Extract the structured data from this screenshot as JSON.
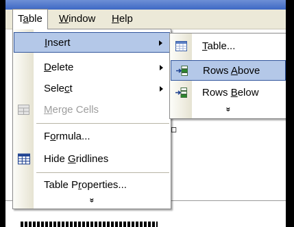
{
  "menubar": {
    "table": {
      "pre": "T",
      "key": "a",
      "post": "ble"
    },
    "window": {
      "pre": "",
      "key": "W",
      "post": "indow"
    },
    "help": {
      "pre": "",
      "key": "H",
      "post": "elp"
    }
  },
  "table_menu": {
    "insert": {
      "pre": "",
      "key": "I",
      "post": "nsert"
    },
    "delete": {
      "pre": "",
      "key": "D",
      "post": "elete"
    },
    "select": {
      "pre": "Sele",
      "key": "c",
      "post": "t"
    },
    "merge_cells": {
      "pre": "",
      "key": "M",
      "post": "erge Cells"
    },
    "formula": {
      "pre": "F",
      "key": "o",
      "post": "rmula..."
    },
    "hide_gridlines": {
      "pre": "Hide ",
      "key": "G",
      "post": "ridlines"
    },
    "table_properties": {
      "pre": "Table P",
      "key": "r",
      "post": "operties..."
    },
    "more": "»"
  },
  "insert_menu": {
    "table": {
      "pre": "",
      "key": "T",
      "post": "able..."
    },
    "rows_above": {
      "pre": "Rows ",
      "key": "A",
      "post": "bove"
    },
    "rows_below": {
      "pre": "Rows ",
      "key": "B",
      "post": "elow"
    },
    "more": "»"
  },
  "doc": {
    "mark": "¨",
    "box": "□"
  },
  "icons": {
    "merge_cells": "merge-cells-icon",
    "hide_gridlines": "gridlines-icon",
    "table": "table-icon",
    "rows_above": "rows-above-icon",
    "rows_below": "rows-below-icon"
  },
  "colors": {
    "highlight": "#b4c8e8",
    "highlight_border": "#31559c",
    "menubar": "#ece9d8",
    "title_blue": "#3e68c4"
  }
}
